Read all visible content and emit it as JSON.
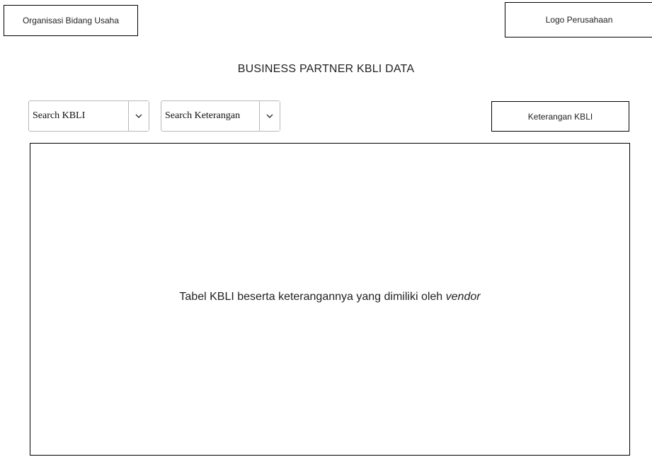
{
  "header": {
    "org_label": "Organisasi Bidang Usaha",
    "logo_label": "Logo Perusahaan"
  },
  "page_title": "BUSINESS PARTNER KBLI DATA",
  "filters": {
    "search_kbli": {
      "value": "Search KBLI",
      "icon": "chevron-down-icon"
    },
    "search_keterangan": {
      "value": "Search Keterangan",
      "icon": "chevron-down-icon"
    }
  },
  "keterangan_button": "Keterangan KBLI",
  "table": {
    "caption_text": "Tabel KBLI beserta keterangannya yang dimiliki oleh ",
    "caption_emphasis": "vendor"
  }
}
